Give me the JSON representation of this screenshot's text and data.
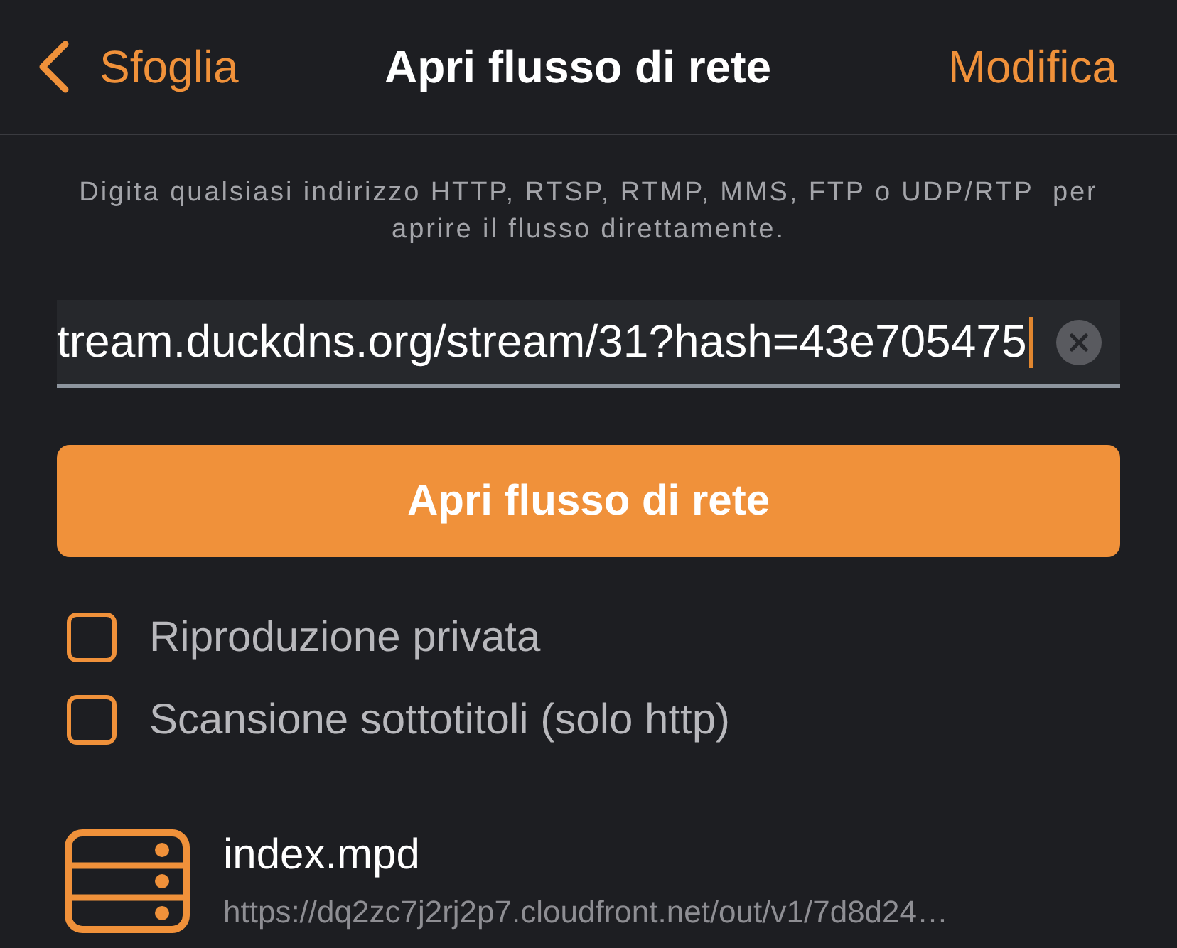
{
  "nav": {
    "back_label": "Sfoglia",
    "title": "Apri flusso di rete",
    "action": "Modifica"
  },
  "description": "Digita qualsiasi indirizzo HTTP, RTSP, RTMP, MMS, FTP o UDP/RTP  per aprire il flusso direttamente.",
  "url_field": {
    "value": "tream.duckdns.org/stream/31?hash=43e705475",
    "focused": true
  },
  "open_button": "Apri flusso di rete",
  "options": [
    {
      "label": "Riproduzione privata",
      "checked": false
    },
    {
      "label": "Scansione sottotitoli (solo http)",
      "checked": false
    }
  ],
  "recent_streams": [
    {
      "title": "index.mpd",
      "url": "https://dq2zc7j2rj2p7.cloudfront.net/out/v1/7d8d24…"
    }
  ]
}
